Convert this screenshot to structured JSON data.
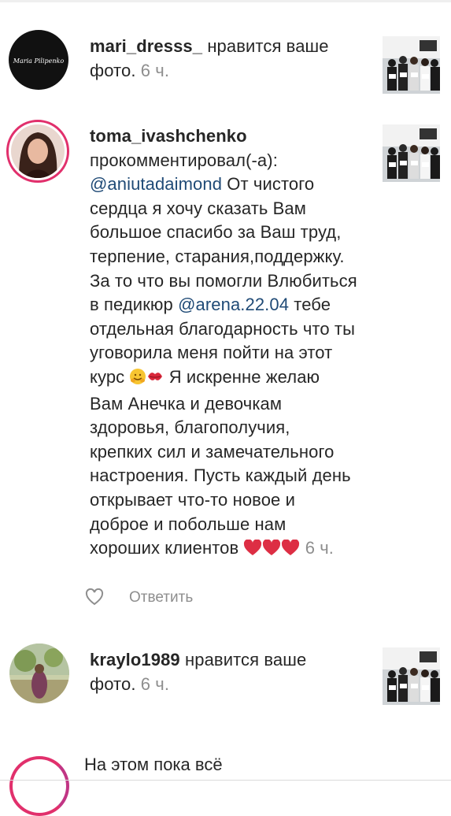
{
  "notifications": [
    {
      "username": "mari_dresss_",
      "action": "нравится ваше фото.",
      "time": "6 ч.",
      "avatar_text": "Maria Pilipenko"
    },
    {
      "username": "toma_ivashchenko",
      "action": "прокомментировал(-а):",
      "mention1": "@aniutadaimond",
      "comment_part1": "От чистого сердца я хочу сказать Вам большое спасибо за Ваш труд, терпение, старания,поддержку. За то что вы помогли Влюбиться в педикюр",
      "mention2": "@arena.22.04",
      "comment_part2": "тебе отдельная благодарность что ты уговорила меня пойти на этот курс",
      "comment_part3": "Я искренне желаю Вам Анечка и девочкам здоровья, благополучия, крепких сил и замечательного настроения. Пусть каждый день открывает что-то новое и доброе и побольше нам хороших клиентов",
      "time": "6 ч.",
      "reply_label": "Ответить"
    },
    {
      "username": "kraylo1989",
      "action": "нравится ваше фото.",
      "time": "6 ч."
    }
  ],
  "footer": {
    "end_text": "На этом пока всё"
  },
  "icons": {
    "like": "heart-outline-icon"
  }
}
